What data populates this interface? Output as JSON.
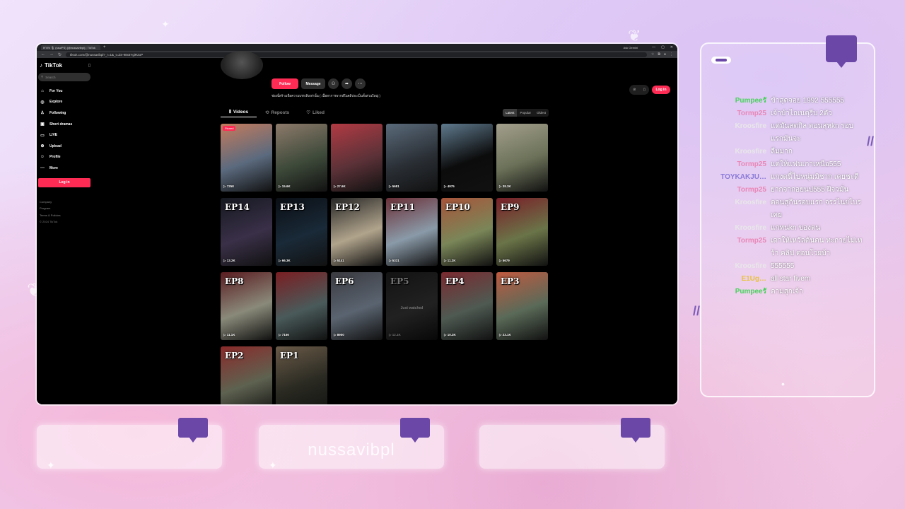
{
  "browser": {
    "tab_title": "พากษ 🎙 (ssu/PS) (@nussavibpl) | TikTok",
    "tab_new": "+",
    "ask_label": "Ask Gemini",
    "url": "tiktok.com/@nussavibpl?_r=1&_t=ZS-98x6YgiR2oP",
    "win_controls": [
      "—",
      "▢",
      "✕"
    ]
  },
  "sidebar": {
    "logo": "TikTok",
    "search_placeholder": "Search",
    "items": [
      {
        "icon": "home-icon",
        "glyph": "⌂",
        "label": "For You"
      },
      {
        "icon": "compass-icon",
        "glyph": "◎",
        "label": "Explore"
      },
      {
        "icon": "following-icon",
        "glyph": "♙",
        "label": "Following"
      },
      {
        "icon": "dramas-icon",
        "glyph": "▣",
        "label": "Short dramas"
      },
      {
        "icon": "live-icon",
        "glyph": "▭",
        "label": "LIVE"
      },
      {
        "icon": "upload-icon",
        "glyph": "⊕",
        "label": "Upload"
      },
      {
        "icon": "profile-icon",
        "glyph": "☺",
        "label": "Profile"
      },
      {
        "icon": "more-icon",
        "glyph": "⋯",
        "label": "More"
      }
    ],
    "login_label": "Log in",
    "footer": [
      "Company",
      "Program",
      "Terms & Policies",
      "© 2024 TikTok"
    ]
  },
  "profile": {
    "follow_label": "Follow",
    "message_label": "Message",
    "bio": "ช่องนี้สร้างเพื่อความบรรเทิงเท่านั้น ( เนื้อหาการพากษ์ในคลิปจะเป็นตั้งส่วนใหญ่ )",
    "login_label": "Log in",
    "tabs": [
      {
        "label": "Videos",
        "glyph": "⦀"
      },
      {
        "label": "Reposts",
        "glyph": "⟲"
      },
      {
        "label": "Liked",
        "glyph": "♡"
      }
    ],
    "sort_options": [
      "Latest",
      "Popular",
      "Oldest"
    ],
    "sort_selected": "Latest"
  },
  "videos": [
    {
      "ep": "",
      "views": "7258",
      "pinned": "Pinned",
      "color": "#5b6a7e",
      "color2": "#c47b5c"
    },
    {
      "ep": "",
      "views": "15.6K",
      "color": "#3e4a3a",
      "color2": "#8d7a6b"
    },
    {
      "ep": "",
      "views": "27.6K",
      "color": "#5c3238",
      "color2": "#b23a43"
    },
    {
      "ep": "",
      "views": "5681",
      "color": "#2a2f35",
      "color2": "#5a6a7a"
    },
    {
      "ep": "",
      "views": "4975",
      "color": "#0c0c0c",
      "color2": "#5f7a8e"
    },
    {
      "ep": "",
      "views": "38.3K",
      "color": "#6b7158",
      "color2": "#a39f8c"
    },
    {
      "ep": "EP14",
      "views": "13.2K",
      "color": "#3a3048",
      "color2": "#151820"
    },
    {
      "ep": "EP13",
      "views": "66.3K",
      "color": "#1a2a38",
      "color2": "#0a0e14"
    },
    {
      "ep": "EP12",
      "views": "5141",
      "color": "#b1a48c",
      "color2": "#262626"
    },
    {
      "ep": "EP11",
      "views": "5331",
      "color": "#8a9aa8",
      "color2": "#6b3038"
    },
    {
      "ep": "EP10",
      "views": "11.2K",
      "color": "#7a8658",
      "color2": "#a8543a"
    },
    {
      "ep": "EP9",
      "views": "5679",
      "color": "#6a7448",
      "color2": "#7a1e28"
    },
    {
      "ep": "EP8",
      "views": "11.1K",
      "color": "#8a8a7a",
      "color2": "#5a1c20"
    },
    {
      "ep": "",
      "views": "7156",
      "color": "#4a5a5a",
      "color2": "#7a1e22"
    },
    {
      "ep": "EP6",
      "views": "8900",
      "color": "#5a6470",
      "color2": "#3a3a40"
    },
    {
      "ep": "EP5",
      "views": "12.1K",
      "watched": "Just watched",
      "dim": true,
      "color": "#4a4a4a",
      "color2": "#2a2a2a"
    },
    {
      "ep": "EP4",
      "views": "10.3K",
      "color": "#4e5a52",
      "color2": "#7a2a30"
    },
    {
      "ep": "EP3",
      "views": "23.1K",
      "color": "#5a6a58",
      "color2": "#c05a40"
    },
    {
      "ep": "EP2",
      "views": "12.3K",
      "color": "#5e6250",
      "color2": "#8a2a2a"
    },
    {
      "ep": "EP1",
      "views": "6901",
      "color": "#2a2a22",
      "color2": "#6a5a48"
    }
  ],
  "chat": {
    "messages": [
      {
        "user": "Pumpeeรั",
        "user_color": "#46d35a",
        "text": "ข้าสุดจอย 1992 555555"
      },
      {
        "user": "Tormp25",
        "user_color": "#e986b6",
        "text": "เจ้าบ้าไถเนตุรีบ 2ตัว"
      },
      {
        "user": "Kroosfire",
        "user_color": "#e8e8e8",
        "text": "แต่มันสตกิล ตอนสุหkn รอบแรกมันจะ"
      },
      {
        "user": "Kroosfire",
        "user_color": "#e8e8e8",
        "text": "ลืมมาก"
      },
      {
        "user": "Tormp25",
        "user_color": "#e986b6",
        "text": "แต่ให้แฟนเกาเหนือ555"
      },
      {
        "user": "TOYKAKJU…",
        "user_color": "#8a7bd8",
        "text": "แกงตนี้ไปหนุ่มมิชาก เคยชะดี"
      },
      {
        "user": "Tormp25",
        "user_color": "#e986b6",
        "text": "ยากจากอยนป555 ฝีจวมั่น"
      },
      {
        "user": "Kroosfire",
        "user_color": "#e8e8e8",
        "text": "ตอนสุกินรอบแรก จรรไนยไบรเคย"
      },
      {
        "user": "Kroosfire",
        "user_color": "#e8e8e8",
        "text": "แกทนkn ของตน"
      },
      {
        "user": "Tormp25",
        "user_color": "#e986b6",
        "text": "เดาให้เหวัลต้นตน ทะกายไม่เทว้า คลิป ตอนโวยบ้า"
      },
      {
        "user": "Kroosfire",
        "user_color": "#e8e8e8",
        "text": "555555"
      },
      {
        "user": "E1Ug…",
        "user_color": "#e8c240",
        "text": "all star fivem"
      },
      {
        "user": "Pumpeeรั",
        "user_color": "#46d35a",
        "text": "ตามสุกเจ้า"
      }
    ]
  },
  "cards": [
    {
      "text": ""
    },
    {
      "text": "nussavibpl"
    },
    {
      "text": ""
    }
  ]
}
